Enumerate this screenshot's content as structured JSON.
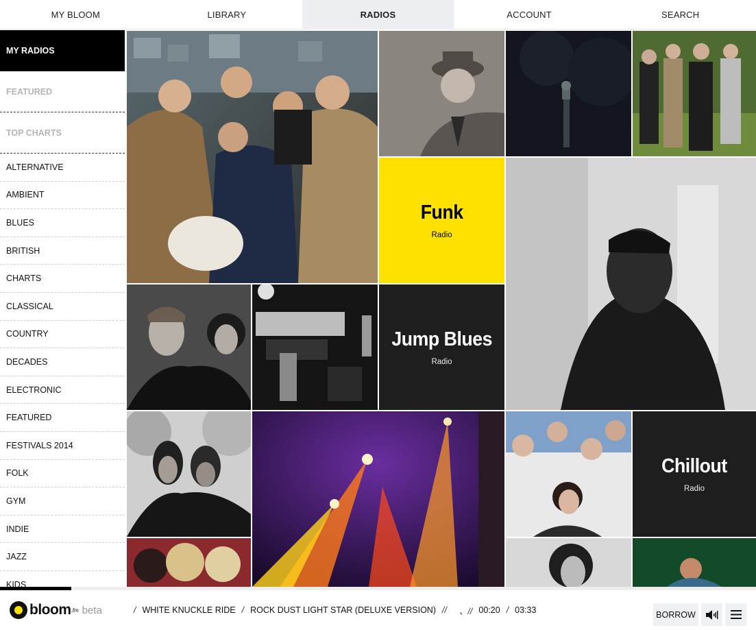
{
  "nav": {
    "tabs": [
      {
        "label": "MY BLOOM"
      },
      {
        "label": "LIBRARY"
      },
      {
        "label": "RADIOS",
        "active": true
      },
      {
        "label": "ACCOUNT"
      },
      {
        "label": "SEARCH"
      }
    ]
  },
  "sidebar": {
    "main": [
      {
        "label": "MY RADIOS",
        "active": true
      },
      {
        "label": "FEATURED"
      },
      {
        "label": "TOP CHARTS"
      }
    ],
    "genres": [
      "ALTERNATIVE",
      "AMBIENT",
      "BLUES",
      "BRITISH",
      "CHARTS",
      "CLASSICAL",
      "COUNTRY",
      "DECADES",
      "ELECTRONIC",
      "FEATURED",
      "FESTIVALS 2014",
      "FOLK",
      "GYM",
      "INDIE",
      "JAZZ",
      "KIDS"
    ]
  },
  "tiles": {
    "funk": {
      "name": "Funk",
      "sub": "Radio"
    },
    "jump_blues": {
      "name": "Jump Blues",
      "sub": "Radio"
    },
    "chillout": {
      "name": "Chillout",
      "sub": "Radio"
    }
  },
  "player": {
    "logo": {
      "word": "bloom",
      "fm": ".fm",
      "beta": "beta"
    },
    "track_title": "WHITE KNUCKLE RIDE",
    "album": "ROCK DUST LIGHT STAR (DELUXE VERSION)",
    "elapsed": "00:20",
    "duration": "03:33",
    "progress_fraction": 0.094,
    "borrow_label": "BORROW"
  },
  "colors": {
    "accent": "#ffe100",
    "dark_tile": "#1e1e1e",
    "active_tab_bg": "#eceef1"
  }
}
